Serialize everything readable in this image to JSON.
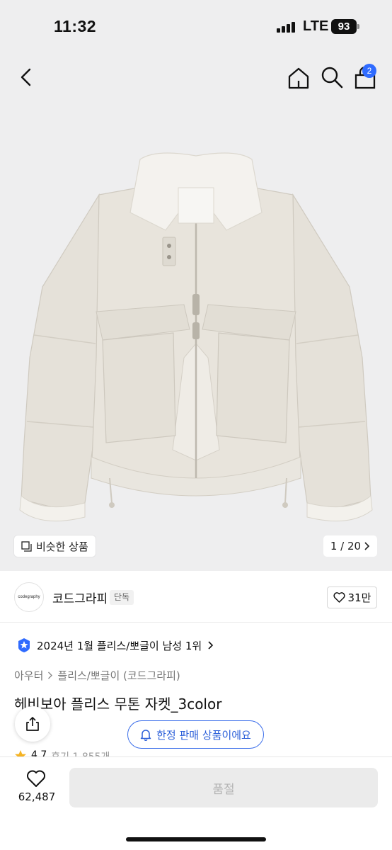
{
  "status_bar": {
    "time": "11:32",
    "network": "LTE",
    "battery": "93"
  },
  "header": {
    "cart_count": "2",
    "icons": [
      "back-icon",
      "home-icon",
      "search-icon",
      "cart-icon"
    ]
  },
  "gallery": {
    "similar_label": "비슷한 상품",
    "counter": "1 / 20"
  },
  "brand": {
    "logo_text": "codegraphy",
    "name": "코드그라피",
    "tag": "단독",
    "like_count": "31만"
  },
  "ranking": {
    "text": "2024년 1월 플리스/뽀글이 남성 1위"
  },
  "category": {
    "parent": "아우터",
    "child": "플리스/뽀글이 (코드그라피)"
  },
  "product": {
    "title": "헤비보아 플리스 무톤 자켓_3color"
  },
  "notice": {
    "limited_label": "한정 판매 상품이에요"
  },
  "rating": {
    "score": "4.7",
    "reviews": "후기 1,855개"
  },
  "bottom": {
    "wish_count": "62,487",
    "buy_label": "품절"
  },
  "colors": {
    "accent": "#2f6bff",
    "limited": "#2b5fd9",
    "hero_bg": "#eeeeef",
    "jacket": "#e6e2da"
  }
}
